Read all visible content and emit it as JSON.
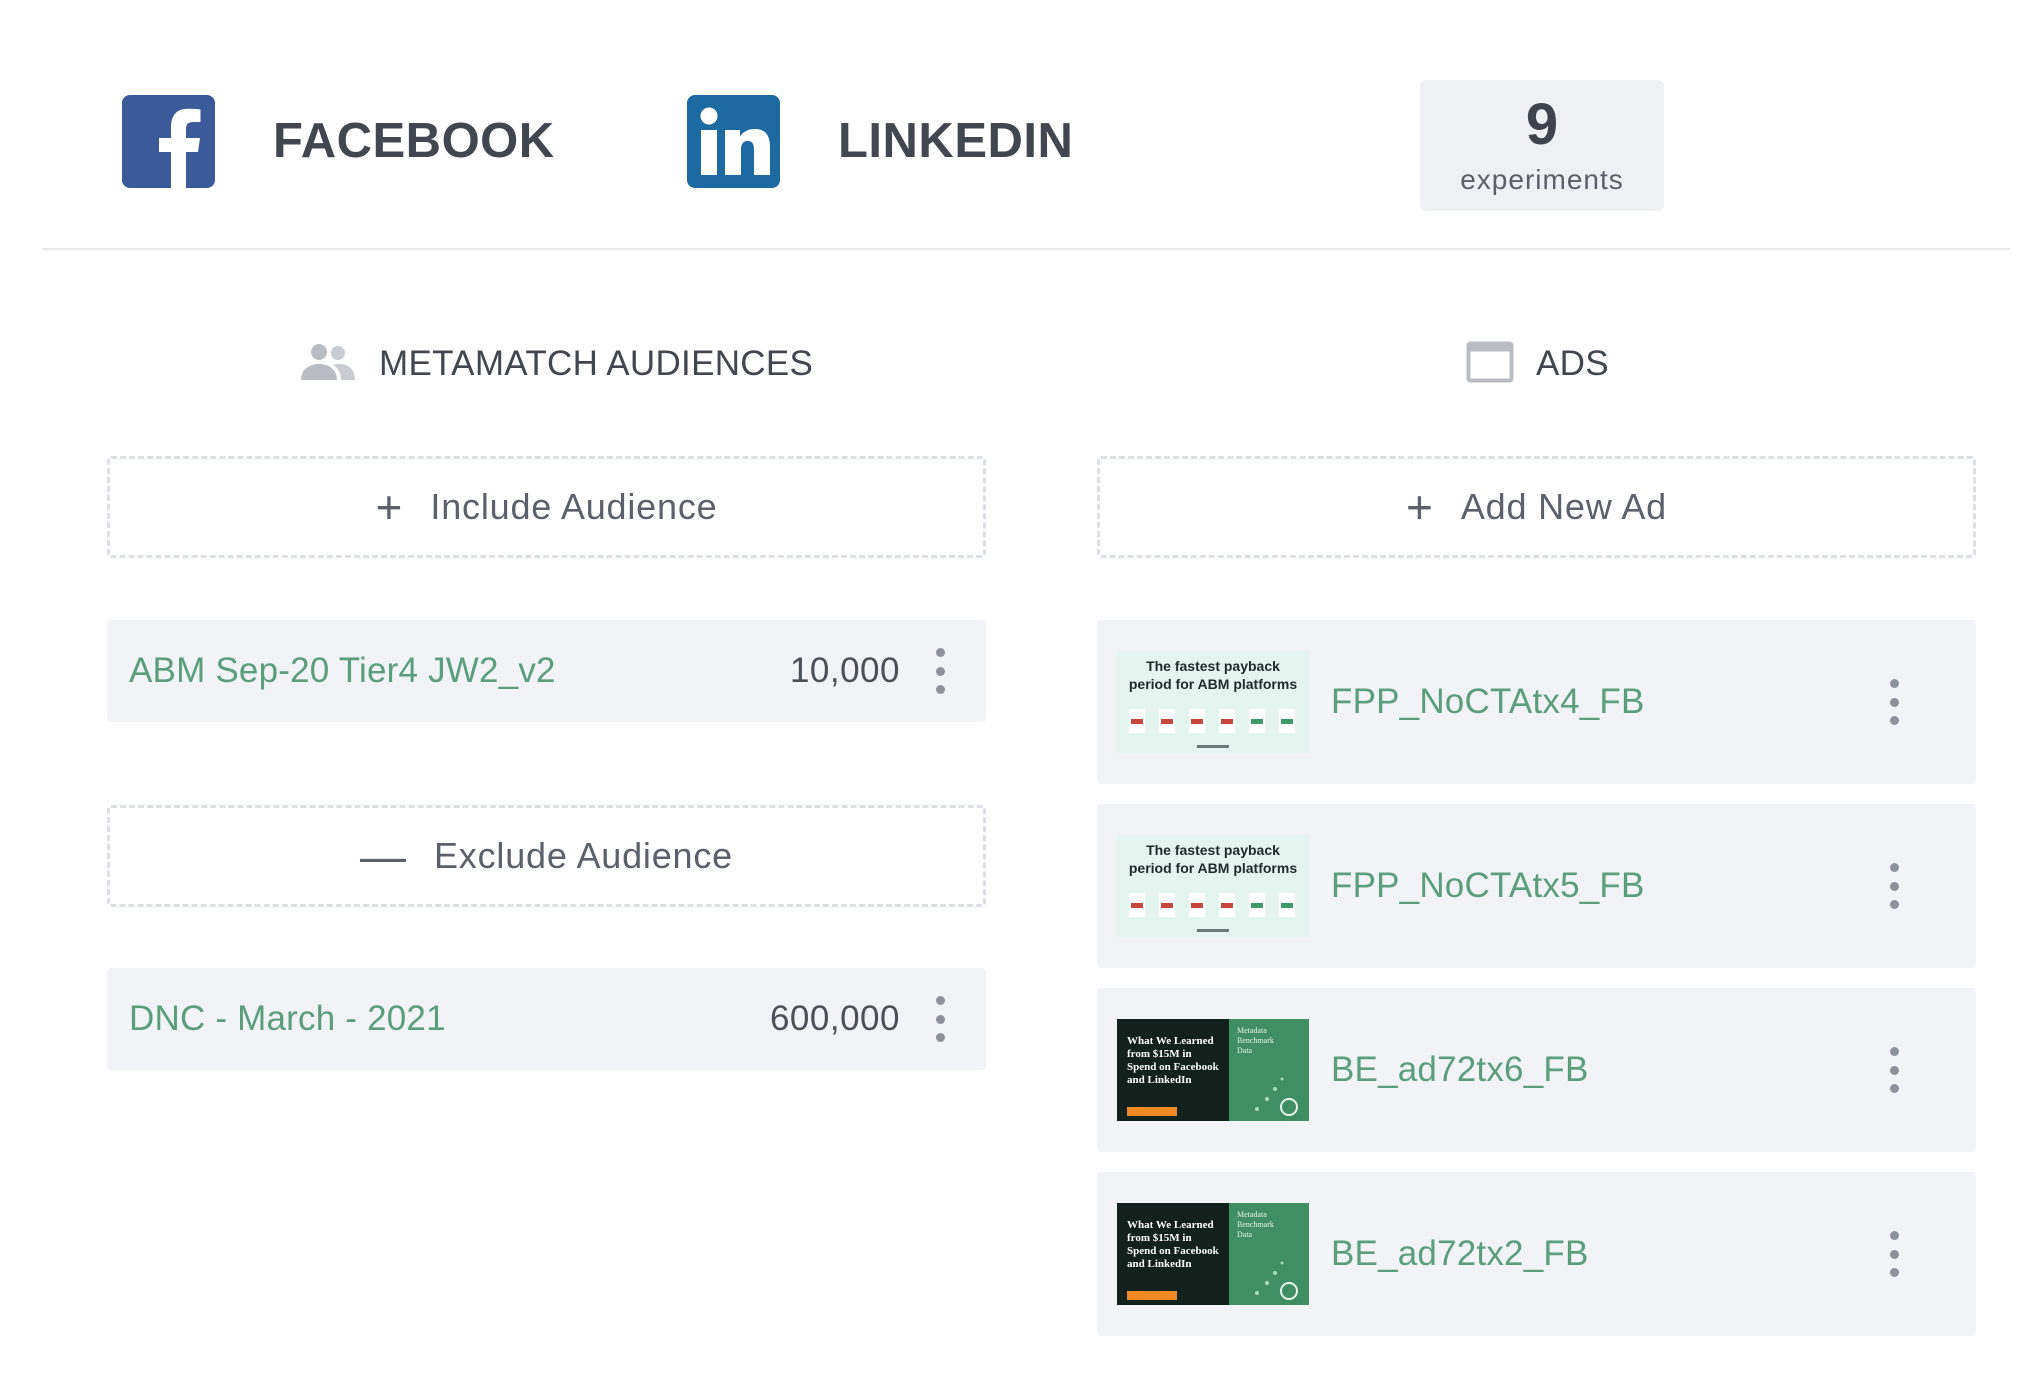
{
  "header": {
    "facebook": {
      "label": "FACEBOOK",
      "icon": "facebook-icon",
      "color": "#3b5a9a"
    },
    "linkedin": {
      "label": "LINKEDIN",
      "icon": "linkedin-icon",
      "color": "#1d69a2"
    },
    "experiments": {
      "count": "9",
      "label": "experiments"
    }
  },
  "audiences": {
    "title": "METAMATCH AUDIENCES",
    "icon": "people-icon",
    "include_label": "Include Audience",
    "exclude_label": "Exclude Audience",
    "included": [
      {
        "name": "ABM Sep-20 Tier4 JW2_v2",
        "count": "10,000"
      }
    ],
    "excluded": [
      {
        "name": "DNC - March - 2021",
        "count": "600,000"
      }
    ]
  },
  "ads": {
    "title": "ADS",
    "icon": "window-icon",
    "add_label": "Add New Ad",
    "items": [
      {
        "name": "FPP_NoCTAtx4_FB",
        "thumb_text": [
          "The fastest payback",
          "period for ABM platforms"
        ]
      },
      {
        "name": "FPP_NoCTAtx5_FB",
        "thumb_text": [
          "The fastest payback",
          "period for ABM platforms"
        ]
      },
      {
        "name": "BE_ad72tx6_FB",
        "thumb_text": [
          "What We Learned",
          "from $15M in",
          "Spend on Facebook",
          "and LinkedIn"
        ],
        "thumb_side_text": [
          "Metadata",
          "Benchmark",
          "Data"
        ]
      },
      {
        "name": "BE_ad72tx2_FB",
        "thumb_text": [
          "What We Learned",
          "from $15M in",
          "Spend on Facebook",
          "and LinkedIn"
        ],
        "thumb_side_text": [
          "Metadata",
          "Benchmark",
          "Data"
        ]
      }
    ]
  },
  "colors": {
    "accent_green": "#5a9e7c",
    "row_bg": "#f2f3f7",
    "text": "#41464f"
  }
}
